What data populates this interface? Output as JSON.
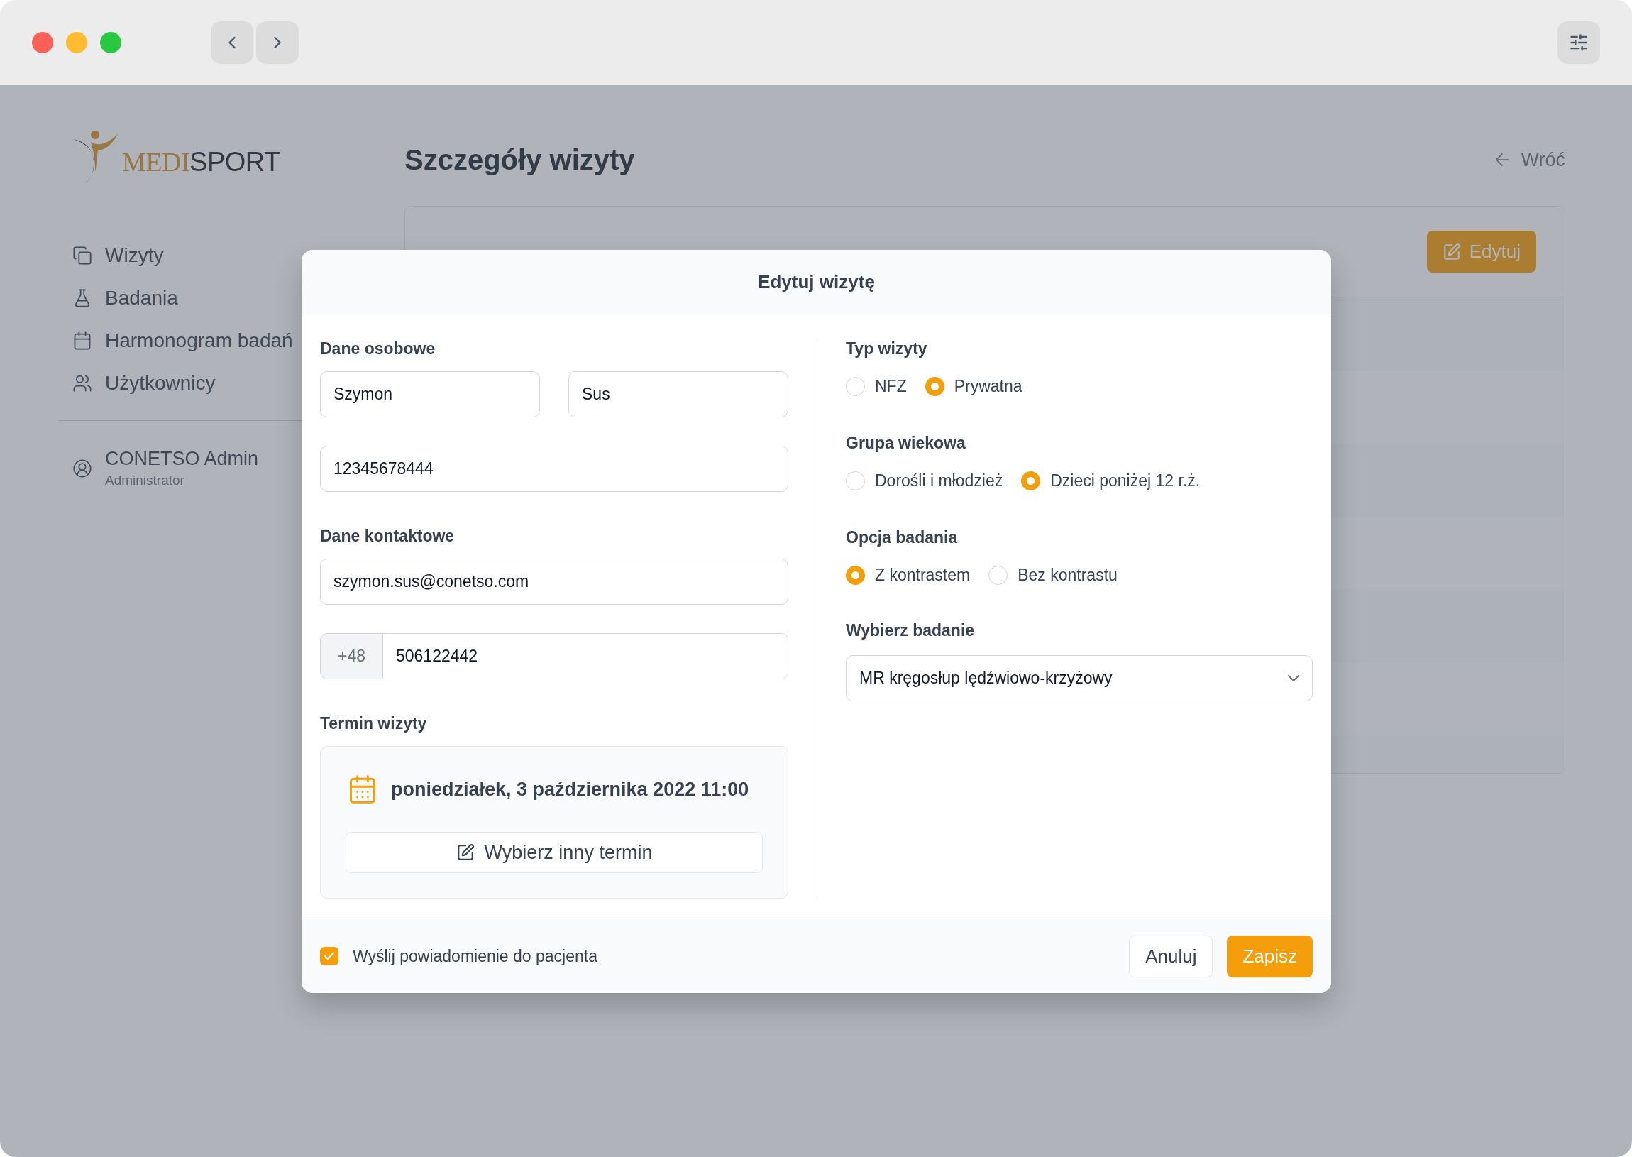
{
  "sidebar": {
    "logo": {
      "accent": "MEDI",
      "rest": "SPORT"
    },
    "items": [
      {
        "label": "Wizyty"
      },
      {
        "label": "Badania"
      },
      {
        "label": "Harmonogram badań"
      },
      {
        "label": "Użytkownicy"
      }
    ],
    "user": {
      "name": "CONETSO Admin",
      "role": "Administrator"
    }
  },
  "page": {
    "title": "Szczegóły wizyty",
    "back_link": "Wróć",
    "card": {
      "edit_button": "Edytuj"
    }
  },
  "modal": {
    "title": "Edytuj wizytę",
    "personal": {
      "heading": "Dane osobowe",
      "first_name": "Szymon",
      "last_name": "Sus",
      "pesel": "12345678444"
    },
    "contact": {
      "heading": "Dane kontaktowe",
      "email": "szymon.sus@conetso.com",
      "phone_prefix": "+48",
      "phone": "506122442"
    },
    "appointment": {
      "heading": "Termin wizyty",
      "date": "poniedziałek, 3 października 2022 11:00",
      "change_button": "Wybierz inny termin"
    },
    "radio_groups": [
      {
        "heading": "Typ wizyty",
        "options": [
          {
            "label": "NFZ",
            "selected": false
          },
          {
            "label": "Prywatna",
            "selected": true
          }
        ]
      },
      {
        "heading": "Grupa wiekowa",
        "options": [
          {
            "label": "Dorośli i młodzież",
            "selected": false
          },
          {
            "label": "Dzieci poniżej 12 r.ż.",
            "selected": true
          }
        ]
      },
      {
        "heading": "Opcja badania",
        "options": [
          {
            "label": "Z kontrastem",
            "selected": true
          },
          {
            "label": "Bez kontrastu",
            "selected": false
          }
        ]
      }
    ],
    "exam": {
      "heading": "Wybierz badanie",
      "value": "MR kręgosłup lędźwiowo-krzyżowy"
    },
    "notify": {
      "label": "Wyślij powiadomienie do pacjenta",
      "checked": true
    },
    "buttons": {
      "cancel": "Anuluj",
      "save": "Zapisz"
    }
  }
}
